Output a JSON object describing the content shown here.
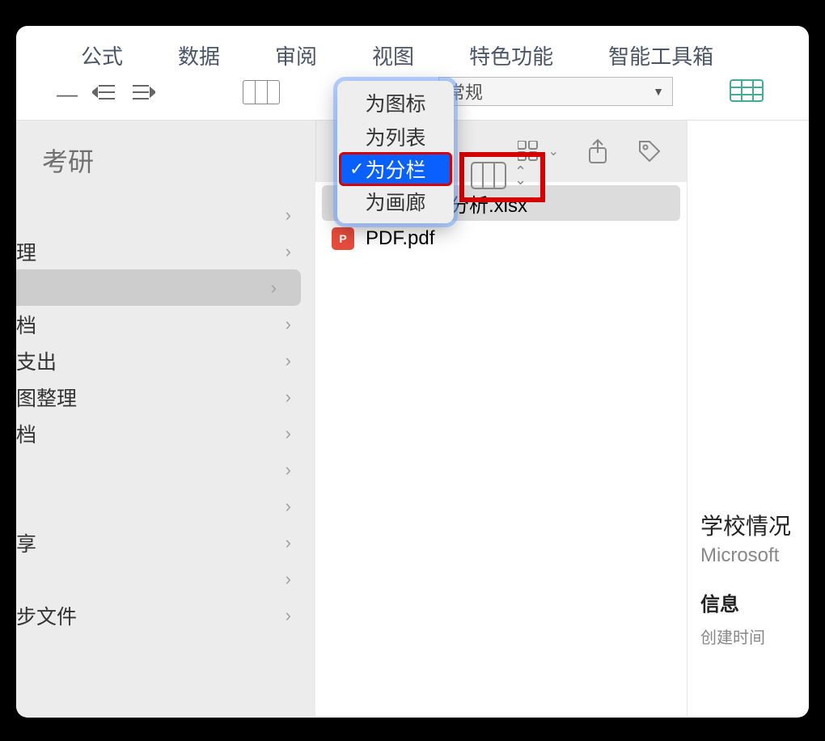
{
  "menubar": {
    "items": [
      "公式",
      "数据",
      "审阅",
      "视图",
      "特色功能",
      "智能工具箱"
    ]
  },
  "toolbar": {
    "style_select": "常规"
  },
  "sidebar": {
    "title": "考研",
    "items": [
      {
        "label": ""
      },
      {
        "label": "理"
      },
      {
        "label": ""
      },
      {
        "label": "档"
      },
      {
        "label": "支出"
      },
      {
        "label": "图整理"
      },
      {
        "label": "档"
      },
      {
        "label": ""
      },
      {
        "label": ""
      },
      {
        "label": "享"
      },
      {
        "label": ""
      },
      {
        "label": "步文件"
      }
    ],
    "selected_index": 2
  },
  "dropdown": {
    "items": [
      "为图标",
      "为列表",
      "为分栏",
      "为画廊"
    ],
    "selected_index": 2
  },
  "files": [
    {
      "name": "学校情况分析.xlsx",
      "type": "xlsx",
      "selected": true
    },
    {
      "name": "PDF.pdf",
      "type": "pdf",
      "selected": false
    }
  ],
  "info": {
    "title": "学校情况",
    "subtitle": "Microsoft",
    "section": "信息",
    "created_label": "创建时间"
  }
}
